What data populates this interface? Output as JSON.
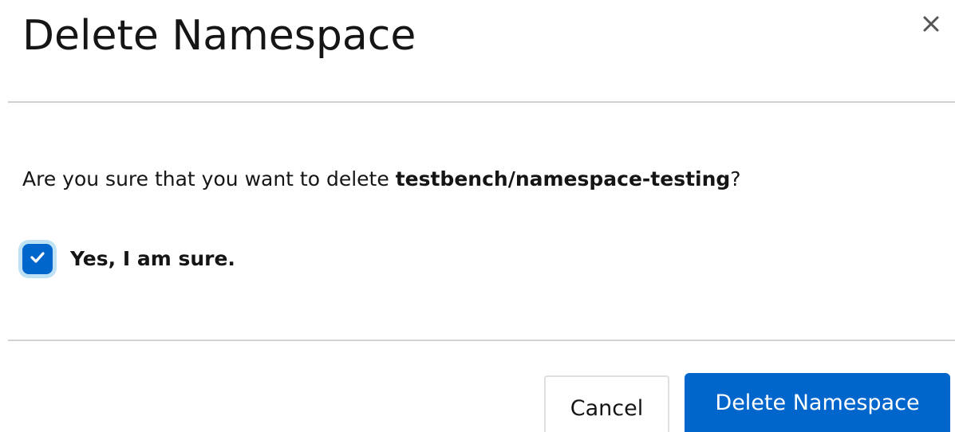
{
  "modal": {
    "title": "Delete Namespace",
    "close_icon": "close-icon",
    "message_prefix": "Are you sure that you want to delete ",
    "namespace_name": "testbench/namespace-testing",
    "message_suffix": "?",
    "confirm_checkbox": {
      "checked": true,
      "label": "Yes, I am sure."
    },
    "buttons": {
      "cancel_label": "Cancel",
      "delete_label": "Delete Namespace"
    }
  },
  "colors": {
    "primary": "#0066cc",
    "divider": "#d2d2d2",
    "text": "#151515",
    "focus_ring": "#bee1f4"
  }
}
